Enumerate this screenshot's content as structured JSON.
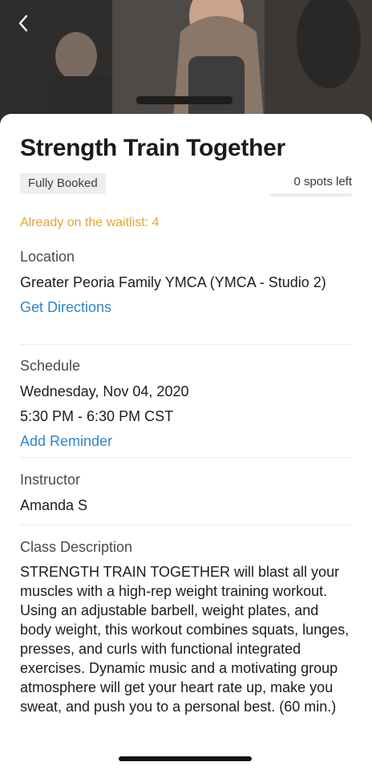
{
  "class": {
    "title": "Strength Train Together",
    "status_badge": "Fully Booked",
    "spots_left": "0 spots left",
    "waitlist": "Already on the waitlist: 4"
  },
  "location": {
    "label": "Location",
    "value": "Greater Peoria Family YMCA (YMCA - Studio 2)",
    "link": "Get Directions"
  },
  "schedule": {
    "label": "Schedule",
    "date": "Wednesday, Nov 04, 2020",
    "time": "5:30 PM - 6:30 PM CST",
    "link": "Add Reminder"
  },
  "instructor": {
    "label": "Instructor",
    "name": "Amanda S"
  },
  "description": {
    "label": "Class Description",
    "text": "STRENGTH TRAIN TOGETHER will blast all your muscles with a high-rep weight training workout. Using an adjustable barbell, weight plates, and body weight, this workout combines squats, lunges, presses, and curls with functional integrated exercises. Dynamic music and a motivating group atmosphere will get your heart rate up, make you sweat, and push you to a personal best. (60 min.)"
  },
  "icons": {
    "back": "chevron-left-icon"
  },
  "colors": {
    "accent_link": "#2f86c8",
    "waitlist": "#e2a532",
    "badge_bg": "#eeeeee"
  }
}
